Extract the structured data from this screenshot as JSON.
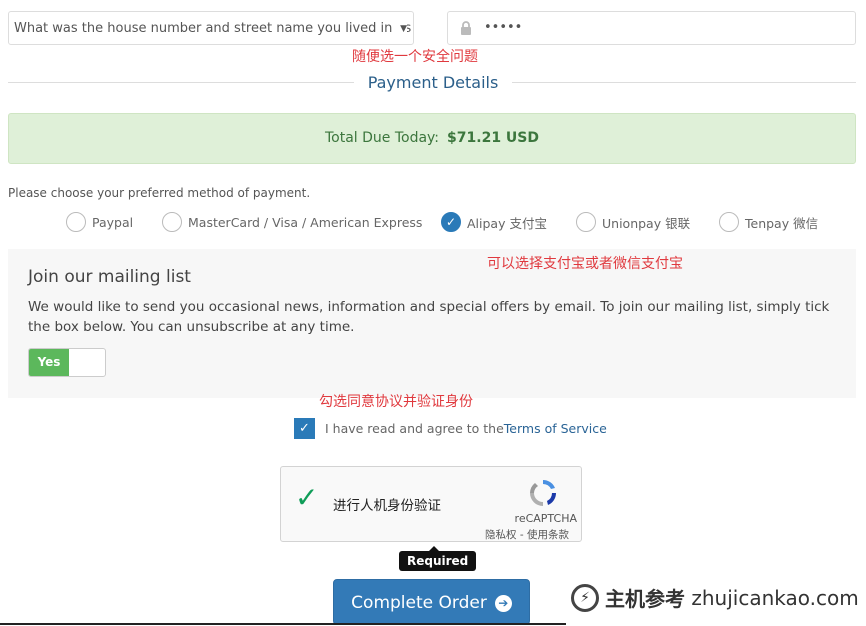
{
  "security": {
    "question": "What was the house number and street name you lived in as a c",
    "answer_masked": "•••••",
    "note": "随便选一个安全问题"
  },
  "payment": {
    "title": "Payment Details",
    "total_label": "Total Due Today:",
    "total_value": "$71.21 USD",
    "choose_text": "Please choose your preferred method of payment.",
    "methods": [
      {
        "label": "Paypal",
        "selected": false
      },
      {
        "label": "MasterCard / Visa / American Express",
        "selected": false
      },
      {
        "label": "Alipay 支付宝",
        "selected": true
      },
      {
        "label": "Unionpay 银联",
        "selected": false
      },
      {
        "label": "Tenpay 微信",
        "selected": false
      }
    ],
    "note": "可以选择支付宝或者微信支付宝"
  },
  "mailing": {
    "title": "Join our mailing list",
    "text": "We would like to send you occasional news, information and special offers by email. To join our mailing list, simply tick the box below. You can unsubscribe at any time.",
    "toggle_label": "Yes",
    "toggle_on": true
  },
  "agree": {
    "note": "勾选同意协议并验证身份",
    "text": "I have read and agree to the ",
    "link": "Terms of Service",
    "checked": true
  },
  "captcha": {
    "label": "进行人机身份验证",
    "brand": "reCAPTCHA",
    "links": "隐私权 - 使用条款",
    "tooltip": "Required"
  },
  "submit": {
    "label": "Complete Order"
  },
  "watermark": {
    "text": "主机参考",
    "domain": "zhujicankao.com"
  },
  "colors": {
    "accent": "#337ab7",
    "success_bg": "#dff0d8",
    "annotation": "#e0393e",
    "toggle_on": "#5cb85c"
  }
}
